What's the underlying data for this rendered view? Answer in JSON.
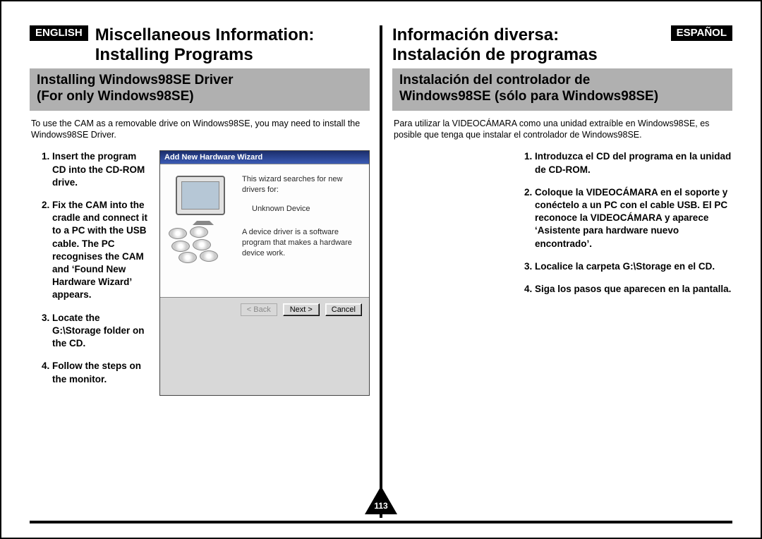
{
  "page_number": "113",
  "left": {
    "lang_label": "ENGLISH",
    "title_line1": "Miscellaneous Information:",
    "title_line2": "Installing Programs",
    "subhead_line1": "Installing Windows98SE Driver",
    "subhead_line2": "For only Windows98SE)",
    "subhead_prefix": "(",
    "intro": "To use the CAM as a removable drive on Windows98SE, you may need to install the Windows98SE Driver.",
    "steps": [
      "Insert the program CD into the CD-ROM drive.",
      "Fix the CAM into the cradle and connect it to a PC with the USB cable. The PC recognises the CAM and ‘Found New Hardware Wizard’ appears.",
      "Locate the G:\\Storage folder on the CD.",
      "Follow the steps on the monitor."
    ]
  },
  "right": {
    "lang_label": "ESPAÑOL",
    "title_line1": "Información diversa:",
    "title_line2": "Instalación de programas",
    "subhead_line1": "Instalación del controlador de",
    "subhead_line2": "Windows98SE (sólo para Windows98SE)",
    "intro": "Para utilizar la VIDEOCÁMARA como una unidad extraíble en Windows98SE, es posible que tenga que instalar el controlador de Windows98SE.",
    "steps": [
      "Introduzca el CD del programa en la unidad de CD-ROM.",
      "Coloque la VIDEOCÁMARA en el soporte y conéctelo a un PC con el cable USB. El PC reconoce la VIDEOCÁMARA y aparece ‘Asistente para hardware nuevo encontrado’.",
      "Localice la carpeta G:\\Storage en el CD.",
      "Siga los pasos que aparecen en la pantalla."
    ]
  },
  "wizard": {
    "title": "Add New Hardware Wizard",
    "line1": "This wizard searches for new drivers for:",
    "device": "Unknown Device",
    "line2": "A device driver is a software program that makes a hardware device work.",
    "btn_back": "< Back",
    "btn_next": "Next >",
    "btn_cancel": "Cancel"
  }
}
